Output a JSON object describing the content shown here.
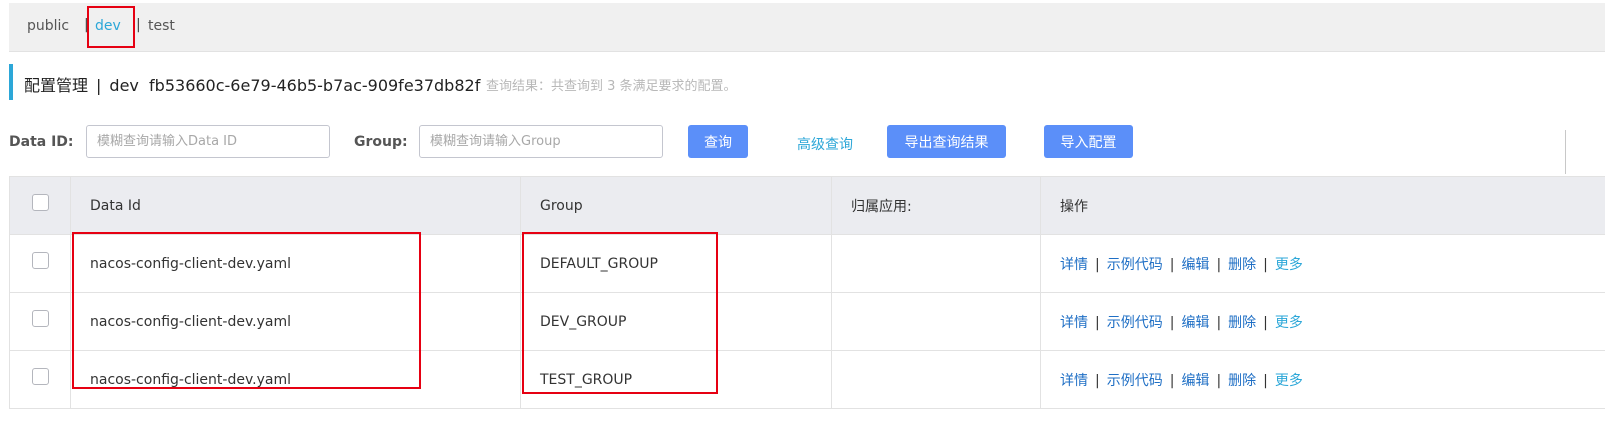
{
  "namespaces": {
    "items": [
      "public",
      "dev",
      "test"
    ],
    "separator": "|"
  },
  "header": {
    "title": "配置管理",
    "separator": "|",
    "namespace_name": "dev",
    "namespace_id": "fb53660c-6e79-46b5-b7ac-909fe37db82f",
    "result_text": "查询结果：共查询到 3 条满足要求的配置。"
  },
  "search": {
    "data_id_label": "Data ID:",
    "data_id_placeholder": "模糊查询请输入Data ID",
    "data_id_value": "",
    "group_label": "Group:",
    "group_placeholder": "模糊查询请输入Group",
    "group_value": "",
    "query_button": "查询",
    "advanced_query": "高级查询",
    "export_button": "导出查询结果",
    "import_button": "导入配置"
  },
  "table": {
    "headers": [
      "Data Id",
      "Group",
      "归属应用:",
      "操作"
    ],
    "rows": [
      {
        "data_id": "nacos-config-client-dev.yaml",
        "group": "DEFAULT_GROUP",
        "app": ""
      },
      {
        "data_id": "nacos-config-client-dev.yaml",
        "group": "DEV_GROUP",
        "app": ""
      },
      {
        "data_id": "nacos-config-client-dev.yaml",
        "group": "TEST_GROUP",
        "app": ""
      }
    ],
    "actions": {
      "detail": "详情",
      "sample_code": "示例代码",
      "edit": "编辑",
      "delete": "删除",
      "more": "更多",
      "separator": "|"
    }
  },
  "colors": {
    "accent": "#2ca7d8",
    "button": "#5b8ff9",
    "link": "#1f6fc5",
    "highlight_box": "#e60012",
    "header_bg": "#ebecf0"
  }
}
